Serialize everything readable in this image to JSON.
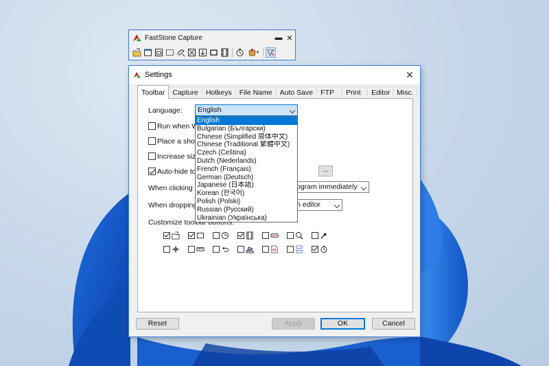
{
  "toolbar_window": {
    "title": "FastStone Capture",
    "minimize": "▬",
    "close": "✕",
    "icons": [
      "open-file-icon",
      "capture-window-icon",
      "capture-object-icon",
      "capture-rectangle-icon",
      "capture-freehand-icon",
      "capture-fullscreen-icon",
      "capture-scrolling-icon",
      "capture-fixed-region-icon",
      "screen-record-icon",
      "delay-timer-icon",
      "output-destination-icon",
      "settings-icon"
    ]
  },
  "dialog": {
    "title": "Settings",
    "close": "✕",
    "tabs": [
      "Toolbar",
      "Capture",
      "Hotkeys",
      "File Name",
      "Auto Save",
      "FTP",
      "Print",
      "Editor",
      "Misc."
    ],
    "active_tab": "Toolbar",
    "language_label": "Language:",
    "language_value": "English",
    "run_when": "Run when Wi",
    "place_shortcut": "Place a shorte",
    "increase_size": "Increase size",
    "auto_hide": "Auto-hide to",
    "dots": "...",
    "when_clicking": "When clicking o",
    "when_clicking_value": "ogram immediately",
    "when_dropping": "When dropping",
    "when_dropping_value": "n editor",
    "customize_label": "Customize toolbar buttons:",
    "buttons": {
      "reset": "Reset",
      "apply": "Apply",
      "ok": "OK",
      "cancel": "Cancel"
    }
  },
  "language_options": [
    "English",
    "Bulgarian (Български)",
    "Chinese (Simplified 简体中文)",
    "Chinese (Traditional 繁體中文)",
    "Czech (Čeština)",
    "Dutch (Nederlands)",
    "French (Français)",
    "German (Deutsch)",
    "Japanese (日本語)",
    "Korean (한국어)",
    "Polish (Polski)",
    "Russian (Русский)",
    "Ukrainian (Українська)"
  ],
  "customize_icons": [
    {
      "icon": "open-file-icon",
      "checked": true
    },
    {
      "icon": "capture-window-icon",
      "checked": true
    },
    {
      "icon": "timer-clock-icon",
      "checked": false
    },
    {
      "icon": "film-strip-icon",
      "checked": true
    },
    {
      "icon": "fixed-region-icon",
      "checked": false
    },
    {
      "icon": "magnifier-icon",
      "checked": false
    },
    {
      "icon": "color-picker-icon",
      "checked": false
    },
    {
      "icon": "crosshair-icon",
      "checked": false
    },
    {
      "icon": "ruler-icon",
      "checked": false
    },
    {
      "icon": "undo-arrow-icon",
      "checked": false
    },
    {
      "icon": "scanner-icon",
      "checked": false
    },
    {
      "icon": "pdf-icon",
      "checked": false
    },
    {
      "icon": "split-layout-icon",
      "checked": false
    },
    {
      "icon": "delay-timer-icon",
      "checked": true
    }
  ],
  "colors": {
    "accent": "#0078d7",
    "border": "#3d7fd8",
    "selection": "#0078d7"
  }
}
